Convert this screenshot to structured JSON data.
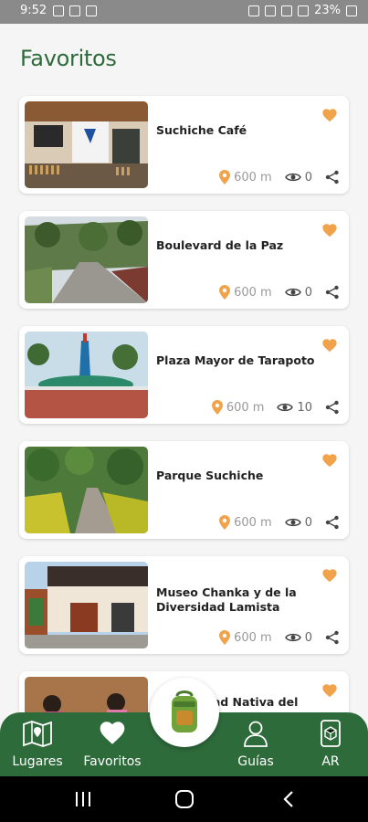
{
  "status": {
    "time": "9:52",
    "battery": "23%"
  },
  "header": {
    "title": "Favoritos"
  },
  "places": [
    {
      "name": "Suchiche Café",
      "distance": "600 m",
      "views": "0"
    },
    {
      "name": "Boulevard de la Paz",
      "distance": "600 m",
      "views": "0"
    },
    {
      "name": "Plaza Mayor de Tarapoto",
      "distance": "600 m",
      "views": "10"
    },
    {
      "name": "Parque Suchiche",
      "distance": "600 m",
      "views": "0"
    },
    {
      "name": "Museo Chanka y de la Diversidad Lamista",
      "distance": "600 m",
      "views": "0"
    },
    {
      "name": "Comunidad Nativa del Wayku"
    }
  ],
  "nav": {
    "lugares": "Lugares",
    "favoritos": "Favoritos",
    "guias": "Guías",
    "ar": "AR"
  },
  "colors": {
    "primary": "#2e6b3b",
    "accent": "#f0a34a"
  }
}
